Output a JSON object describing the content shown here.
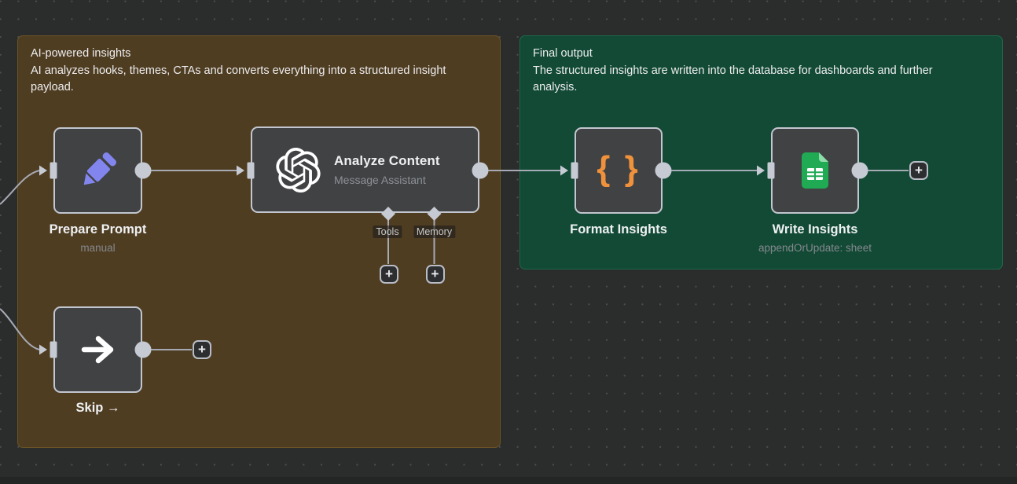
{
  "canvas": {
    "background": "#2b2c2c",
    "dot_color": "#515253",
    "bottom_bar_color": "#242525"
  },
  "colors": {
    "node_fill": "#414244",
    "node_border": "#c2c6cf",
    "connector": "#a6aab4",
    "endpoint": "#c6cad3",
    "pencil_icon": "#8285ee",
    "braces_icon": "#f0923c",
    "sheets_icon_green": "#1faa53",
    "sticky_amber_fill": "#4f3d22",
    "sticky_amber_border": "#6b5426",
    "sticky_green_fill": "#124a35",
    "sticky_green_border": "#1e6849"
  },
  "sticky_notes": [
    {
      "title": "AI-powered insights",
      "body": "AI analyzes hooks, themes, CTAs and converts everything into a structured insight payload."
    },
    {
      "title": "Final output",
      "body": "The structured insights are written into the database for dashboards and further analysis."
    }
  ],
  "nodes": [
    {
      "id": "prepare-prompt",
      "name": "Prepare Prompt",
      "subtitle": "manual",
      "icon": "pencil-icon"
    },
    {
      "id": "analyze-content",
      "name": "Analyze Content",
      "subtitle": "Message Assistant",
      "icon": "openai-icon"
    },
    {
      "id": "skip",
      "name": "Skip →",
      "subtitle": "",
      "icon": "arrow-right-icon"
    },
    {
      "id": "format-insights",
      "name": "Format Insights",
      "subtitle": "",
      "icon": "curly-braces-icon",
      "icon_text": "{ }"
    },
    {
      "id": "write-insights",
      "name": "Write Insights",
      "subtitle": "appendOrUpdate: sheet",
      "icon": "google-sheets-icon"
    }
  ],
  "ports": {
    "tools": "Tools",
    "memory": "Memory"
  },
  "plus": "+"
}
